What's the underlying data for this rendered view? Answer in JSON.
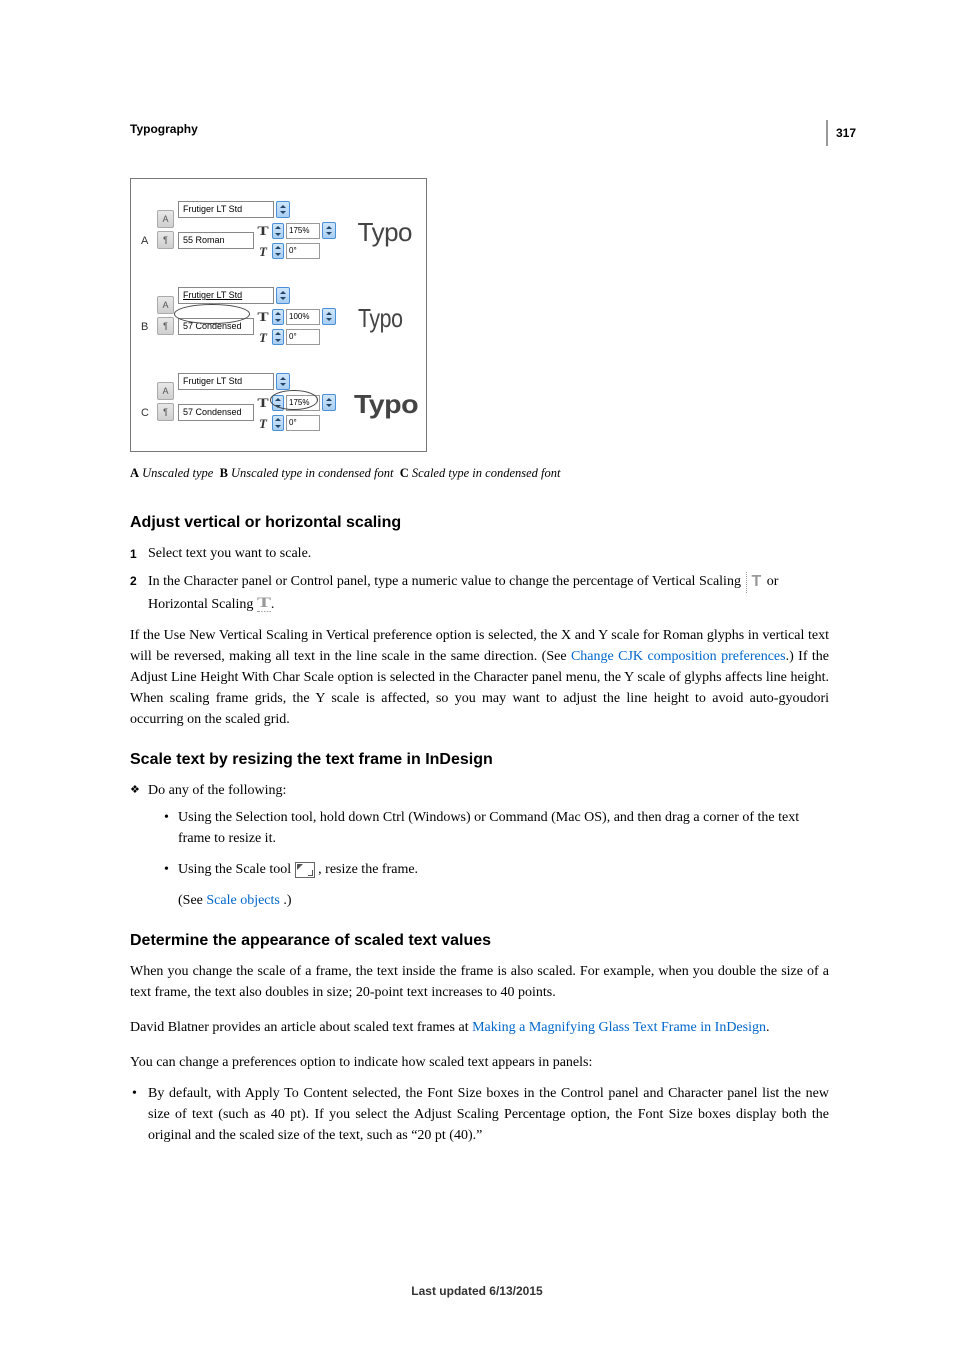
{
  "page_number": "317",
  "header_section": "Typography",
  "figure": {
    "rows": [
      {
        "label": "A",
        "font_family": "Frutiger LT Std",
        "font_style": "55 Roman",
        "h_scale": "175%",
        "skew": "0°",
        "sample": "Typo",
        "circled": "none"
      },
      {
        "label": "B",
        "font_family": "Frutiger LT Std",
        "font_style": "57 Condensed",
        "h_scale": "100%",
        "skew": "0°",
        "sample": "Typo",
        "circled": "style"
      },
      {
        "label": "C",
        "font_family": "Frutiger LT Std",
        "font_style": "57 Condensed",
        "h_scale": "175%",
        "skew": "0°",
        "sample": "Typo",
        "circled": "scale"
      }
    ]
  },
  "caption": {
    "a_label": "A",
    "a_text": "Unscaled type",
    "b_label": "B",
    "b_text": "Unscaled type in condensed font",
    "c_label": "C",
    "c_text": "Scaled type in condensed font"
  },
  "section1": {
    "heading": "Adjust vertical or horizontal scaling",
    "step1": "Select text you want to scale.",
    "step2_a": "In the Character panel or Control panel, type a numeric value to change the percentage of Vertical Scaling ",
    "step2_b": " or Horizontal Scaling ",
    "step2_c": ".",
    "paragraph_a": "If the Use New Vertical Scaling in Vertical preference option is selected, the X and Y scale for Roman glyphs in vertical text will be reversed, making all text in the line scale in the same direction. (See ",
    "paragraph_link": "Change CJK composition preferences",
    "paragraph_b": ".) If the Adjust Line Height With Char Scale option is selected in the Character panel menu, the Y scale of glyphs affects line height. When scaling frame grids, the Y scale is affected, so you may want to adjust the line height to avoid auto-gyoudori occurring on the scaled grid."
  },
  "section2": {
    "heading": "Scale text by resizing the text frame in InDesign",
    "lead": "Do any of the following:",
    "bullet1": "Using the Selection tool, hold down Ctrl (Windows) or Command (Mac OS), and then drag a corner of the text frame to resize it.",
    "bullet2_a": "Using the Scale tool ",
    "bullet2_b": " , resize the frame.",
    "see_a": "(See ",
    "see_link": "Scale objects",
    "see_b": " .)"
  },
  "section3": {
    "heading": "Determine the appearance of scaled text values",
    "p1": "When you change the scale of a frame, the text inside the frame is also scaled. For example, when you double the size of a text frame, the text also doubles in size; 20-point text increases to 40 points.",
    "p2_a": "David Blatner provides an article about scaled text frames at ",
    "p2_link": "Making a Magnifying Glass Text Frame in InDesign",
    "p2_b": ".",
    "p3": "You can change a preferences option to indicate how scaled text appears in panels:",
    "bullet": "By default, with Apply To Content selected, the Font Size boxes in the Control panel and Character panel list the new size of text (such as 40 pt). If you select the Adjust Scaling Percentage option, the Font Size boxes display both the original and the scaled size of the text, such as “20 pt (40).”"
  },
  "footer": "Last updated 6/13/2015"
}
